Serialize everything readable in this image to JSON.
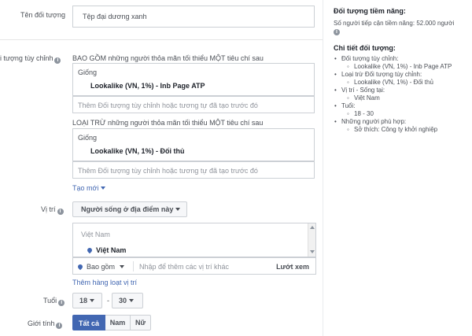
{
  "audience_name": {
    "label": "Tên đối tượng",
    "value": "Tệp đại dương xanh"
  },
  "custom_audience": {
    "label": "i tượng tùy chỉnh",
    "include_header": "BAO GỒM những người thỏa mãn tối thiểu MỘT tiêu chí sau",
    "include_group_label": "Giống",
    "include_item": "Lookalike (VN, 1%) - Inb Page ATP",
    "include_placeholder": "Thêm Đối tượng tùy chỉnh hoặc tương tự đã tạo trước đó",
    "exclude_header": "LOẠI TRỪ những người thỏa mãn tối thiểu MỘT tiêu chí sau",
    "exclude_group_label": "Giống",
    "exclude_item": "Lookalike (VN, 1%) - Đối thủ",
    "exclude_placeholder": "Thêm Đối tượng tùy chỉnh hoặc tương tự đã tạo trước đó",
    "create_new": "Tạo mới"
  },
  "location": {
    "label": "Vị trí",
    "mode_dropdown": "Người sống ở địa điểm này",
    "country_header": "Việt Nam",
    "selected_location": "Việt Nam",
    "include_dropdown": "Bao gồm",
    "search_placeholder": "Nhập để thêm các vị trí khác",
    "browse": "Lướt xem",
    "bulk_add": "Thêm hàng loạt vị trí"
  },
  "age": {
    "label": "Tuổi",
    "min": "18",
    "separator": "-",
    "max": "30"
  },
  "gender": {
    "label": "Giới tính",
    "options": [
      "Tất cả",
      "Nam",
      "Nữ"
    ],
    "selected": "Tất cả"
  },
  "potential": {
    "title": "Đối tượng tiềm năng:",
    "reach": "Số người tiếp cận tiềm năng: 52.000 người"
  },
  "details": {
    "title": "Chi tiết đối tượng:",
    "items": [
      {
        "text": "Đối tượng tùy chỉnh:",
        "sub": false
      },
      {
        "text": "Lookalike (VN, 1%) - Inb Page ATP",
        "sub": true
      },
      {
        "text": "Loại trừ Đối tượng tùy chỉnh:",
        "sub": false
      },
      {
        "text": "Lookalike (VN, 1%) - Đối thủ",
        "sub": true
      },
      {
        "text": "Vị trí - Sống tại:",
        "sub": false
      },
      {
        "text": "Việt Nam",
        "sub": true
      },
      {
        "text": "Tuổi:",
        "sub": false
      },
      {
        "text": "18 - 30",
        "sub": true
      },
      {
        "text": "Những người phù hợp:",
        "sub": false
      },
      {
        "text": "Sở thích: Công ty khởi nghiệp",
        "sub": true
      }
    ]
  },
  "colors": {
    "accent": "#4267b2",
    "border": "#ccd0d5",
    "text": "#4b4f56"
  }
}
